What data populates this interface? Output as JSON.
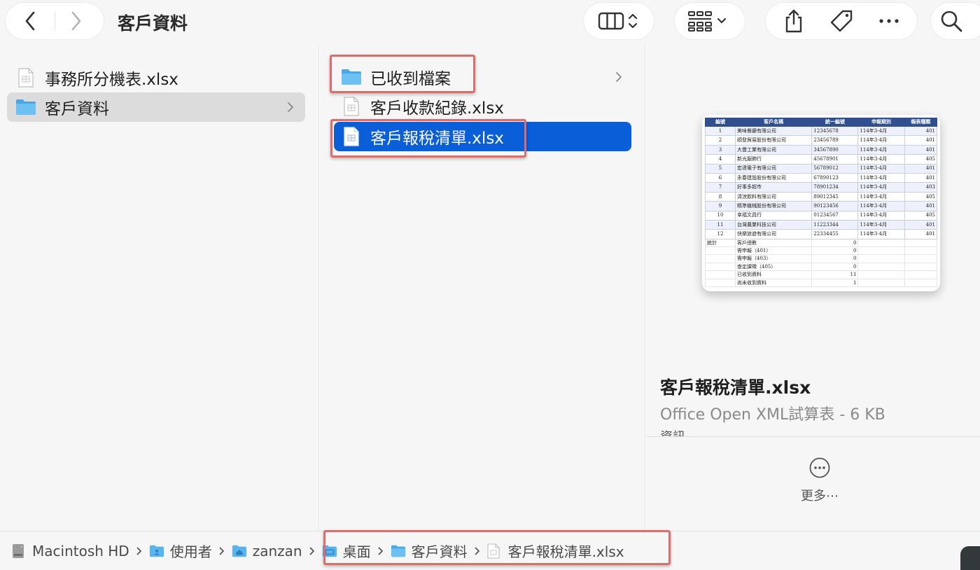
{
  "toolbar": {
    "title": "客戶資料",
    "icons": [
      "chevron-left-icon",
      "chevron-right-icon",
      "columns-view-icon",
      "group-icon",
      "share-icon",
      "tag-icon",
      "more-icon",
      "search-icon"
    ]
  },
  "column1": {
    "items": [
      {
        "label": "事務所分機表.xlsx",
        "icon": "spreadsheet-file-icon"
      },
      {
        "label": "客戶資料",
        "icon": "folder-icon",
        "selected": true
      }
    ]
  },
  "column2": {
    "items": [
      {
        "label": "已收到檔案",
        "icon": "folder-icon"
      },
      {
        "label": "客戶收款紀錄.xlsx",
        "icon": "spreadsheet-file-icon"
      },
      {
        "label": "客戶報稅清單.xlsx",
        "icon": "spreadsheet-file-icon",
        "selected": true
      }
    ]
  },
  "preview": {
    "name": "客戶報稅清單.xlsx",
    "kind": "Office Open XML試算表 - 6 KB",
    "cut_text": "資訊",
    "more_label": "更多⋯",
    "sheet": {
      "headers": [
        "編號",
        "客戶名稱",
        "統一編號",
        "申報期別",
        "報表種類"
      ],
      "rows": [
        [
          "1",
          "美味餐廳有限公司",
          "12345678",
          "114年3-4月",
          "401"
        ],
        [
          "2",
          "順發貿易股份有限公司",
          "23456789",
          "114年3-4月",
          "401"
        ],
        [
          "3",
          "大豐工業有限公司",
          "34567890",
          "114年3-4月",
          "401"
        ],
        [
          "4",
          "新光服飾行",
          "45678901",
          "114年3-4月",
          "405"
        ],
        [
          "5",
          "宏達電子有限公司",
          "56789012",
          "114年3-4月",
          "401"
        ],
        [
          "6",
          "永春建設股份有限公司",
          "67890123",
          "114年3-4月",
          "401"
        ],
        [
          "7",
          "好事多超市",
          "78901234",
          "114年3-4月",
          "403"
        ],
        [
          "8",
          "清涼飲料有限公司",
          "89012345",
          "114年3-4月",
          "405"
        ],
        [
          "9",
          "精準機械股份有限公司",
          "90123456",
          "114年3-4月",
          "401"
        ],
        [
          "10",
          "幸福文具行",
          "01234567",
          "114年3-4月",
          "405"
        ],
        [
          "11",
          "台灣農業科技公司",
          "11223344",
          "114年3-4月",
          "401"
        ],
        [
          "12",
          "快樂旅遊有限公司",
          "22334455",
          "114年3-4月",
          "401"
        ]
      ],
      "summary_label": "統計",
      "summary": [
        [
          "客戶總數",
          "0"
        ],
        [
          "需申報（401）",
          "0"
        ],
        [
          "需申報（403）",
          "0"
        ],
        [
          "查定課徵（405）",
          "0"
        ],
        [
          "已收到資料",
          "11"
        ],
        [
          "尚未收到資料",
          "1"
        ]
      ]
    }
  },
  "pathbar": {
    "crumbs": [
      {
        "label": "Macintosh HD",
        "icon": "hard-drive-icon"
      },
      {
        "label": "使用者",
        "icon": "users-folder-icon"
      },
      {
        "label": "zanzan",
        "icon": "home-folder-icon"
      },
      {
        "label": "桌面",
        "icon": "desktop-folder-icon"
      },
      {
        "label": "客戶資料",
        "icon": "folder-icon"
      },
      {
        "label": "客戶報稅清單.xlsx",
        "icon": "spreadsheet-file-icon"
      }
    ]
  },
  "colors": {
    "selection_blue": "#0a5ed7",
    "highlight_red": "#e46a6a",
    "folder_blue": "#5ab4ec"
  }
}
